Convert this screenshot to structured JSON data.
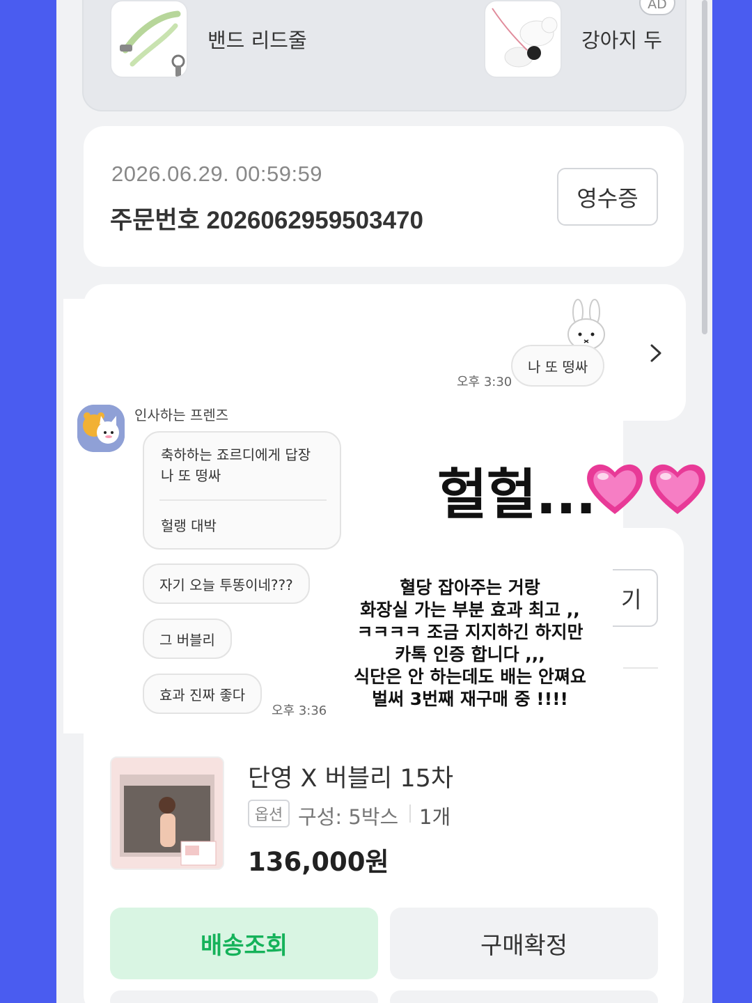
{
  "ads": {
    "badge": "AD",
    "items": [
      {
        "label": "밴드 리드줄",
        "icon": "leash-product-image"
      },
      {
        "label": "강아지 두",
        "icon": "dog-harness-product-image"
      }
    ]
  },
  "order": {
    "datetime": "2026.06.29. 00:59:59",
    "number_label": "주문번호 2026062959503470",
    "receipt_button": "영수증"
  },
  "chat": {
    "my_message": {
      "text": "나 또 떵싸",
      "time": "오후 3:30"
    },
    "friend": {
      "name": "인사하는 프렌즈",
      "reply_header": "축하하는 죠르디에게 답장",
      "reply_quote": "나 또 떵싸",
      "reply_text": "헐랭 대박",
      "messages": [
        "자기 오늘 투똥이네???",
        "그 버블리",
        "효과 진짜 좋다"
      ],
      "time": "오후 3:36"
    }
  },
  "overlay": {
    "big_text": "헐헐...",
    "heart_icon": "pink-heart-emoji",
    "review_lines": [
      "혈당 잡아주는 거랑",
      "화장실 가는 부분 효과 최고 ,,",
      "ㅋㅋㅋㅋ 조금 지지하긴 하지만",
      "카톡 인증 합니다 ,,,",
      "식단은 안 하는데도 배는 안쪄요",
      "벌써 3번째 재구매 중 !!!!"
    ]
  },
  "partial_button": "기",
  "product": {
    "title": "단영 X 버블리 15차",
    "option_tag": "옵션",
    "option_value": "구성: 5박스",
    "quantity": "1개",
    "price": "136,000원"
  },
  "actions": {
    "track_delivery": "배송조회",
    "confirm_purchase": "구매확정"
  },
  "colors": {
    "background": "#4a5cf0",
    "accent_green": "#15b25a",
    "heart_pink": "#f04aa8"
  }
}
